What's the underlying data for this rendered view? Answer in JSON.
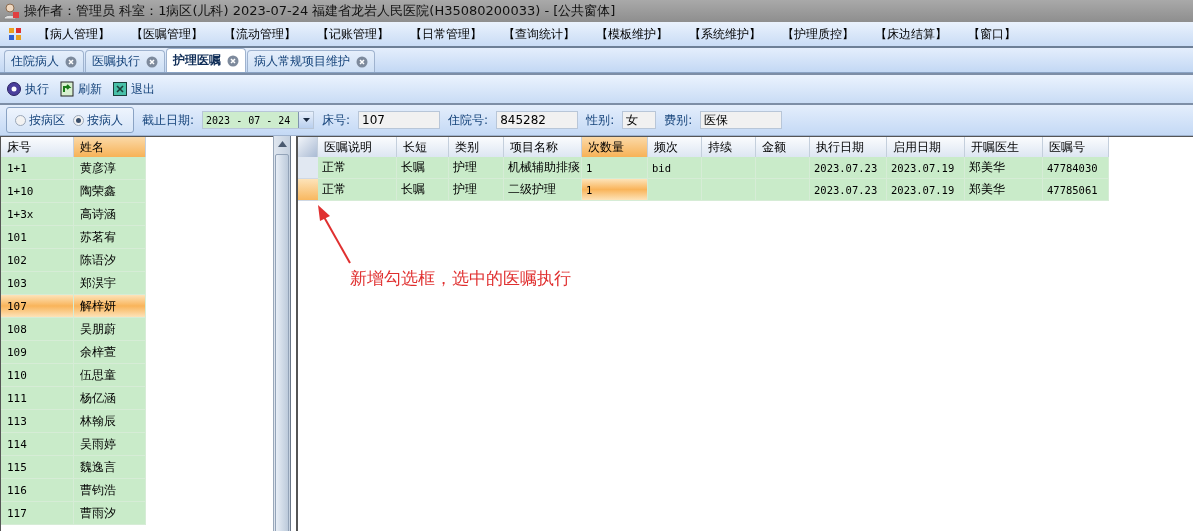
{
  "window": {
    "title": "操作者：管理员  科室：1病区(儿科)  2023-07-24  福建省龙岩人民医院(H35080200033) - [公共窗体]"
  },
  "menu": [
    "【病人管理】",
    "【医嘱管理】",
    "【流动管理】",
    "【记账管理】",
    "【日常管理】",
    "【查询统计】",
    "【模板维护】",
    "【系统维护】",
    "【护理质控】",
    "【床边结算】",
    "【窗口】"
  ],
  "tabs": [
    {
      "label": "住院病人",
      "selected": false
    },
    {
      "label": "医嘱执行",
      "selected": false
    },
    {
      "label": "护理医嘱",
      "selected": true
    },
    {
      "label": "病人常规项目维护",
      "selected": false
    }
  ],
  "toolbar": [
    {
      "label": "执行",
      "kind": "execute"
    },
    {
      "label": "刷新",
      "kind": "refresh"
    },
    {
      "label": "退出",
      "kind": "exit"
    }
  ],
  "filter": {
    "modes": [
      {
        "label": "按病区",
        "selected": false
      },
      {
        "label": "按病人",
        "selected": true
      }
    ],
    "fields": [
      {
        "label": "截止日期:",
        "value": "2023 - 07 - 24",
        "kind": "date"
      },
      {
        "label": "床号:",
        "value": "107",
        "kind": "text"
      },
      {
        "label": "住院号:",
        "value": "845282",
        "kind": "text"
      },
      {
        "label": "性别:",
        "value": "女",
        "kind": "short"
      },
      {
        "label": "费别:",
        "value": "医保",
        "kind": "text"
      }
    ]
  },
  "patients": {
    "columns": [
      {
        "label": "床号",
        "selected": false
      },
      {
        "label": "姓名",
        "selected": true
      }
    ],
    "rows": [
      {
        "bed": "1+1",
        "name": "黄彦淳",
        "selected": false
      },
      {
        "bed": "1+10",
        "name": "陶荣鑫",
        "selected": false
      },
      {
        "bed": "1+3x",
        "name": "高诗涵",
        "selected": false
      },
      {
        "bed": "101",
        "name": "苏茗宥",
        "selected": false
      },
      {
        "bed": "102",
        "name": "陈语汐",
        "selected": false
      },
      {
        "bed": "103",
        "name": "郑淏宇",
        "selected": false
      },
      {
        "bed": "107",
        "name": "解梓妍",
        "selected": true
      },
      {
        "bed": "108",
        "name": "吴朋蔚",
        "selected": false
      },
      {
        "bed": "109",
        "name": "余梓萱",
        "selected": false
      },
      {
        "bed": "110",
        "name": "伍思童",
        "selected": false
      },
      {
        "bed": "111",
        "name": "杨亿涵",
        "selected": false
      },
      {
        "bed": "113",
        "name": "林翰辰",
        "selected": false
      },
      {
        "bed": "114",
        "name": "吴雨婷",
        "selected": false
      },
      {
        "bed": "115",
        "name": "魏逸言",
        "selected": false
      },
      {
        "bed": "116",
        "name": "曹钧浩",
        "selected": false
      },
      {
        "bed": "117",
        "name": "曹雨汐",
        "selected": false
      }
    ]
  },
  "orders": {
    "columns": [
      {
        "label": "医嘱说明",
        "selected": false
      },
      {
        "label": "长短",
        "selected": false
      },
      {
        "label": "类别",
        "selected": false
      },
      {
        "label": "项目名称",
        "selected": false
      },
      {
        "label": "次数量",
        "selected": true
      },
      {
        "label": "频次",
        "selected": false
      },
      {
        "label": "持续",
        "selected": false
      },
      {
        "label": "金额",
        "selected": false
      },
      {
        "label": "执行日期",
        "selected": false
      },
      {
        "label": "启用日期",
        "selected": false
      },
      {
        "label": "开嘱医生",
        "selected": false
      },
      {
        "label": "医嘱号",
        "selected": false
      }
    ],
    "rows": [
      {
        "selected": false,
        "cells": [
          "正常",
          "长嘱",
          "护理",
          "机械辅助排痰",
          "1",
          "bid",
          "",
          "",
          "2023.07.23",
          "2023.07.19",
          "郑美华",
          "47784030"
        ]
      },
      {
        "selected": true,
        "cells": [
          "正常",
          "长嘱",
          "护理",
          "二级护理",
          "1",
          "",
          "",
          "",
          "2023.07.23",
          "2023.07.19",
          "郑美华",
          "47785061"
        ]
      }
    ]
  },
  "annotation": {
    "text": "新增勾选框，选中的医嘱执行"
  }
}
